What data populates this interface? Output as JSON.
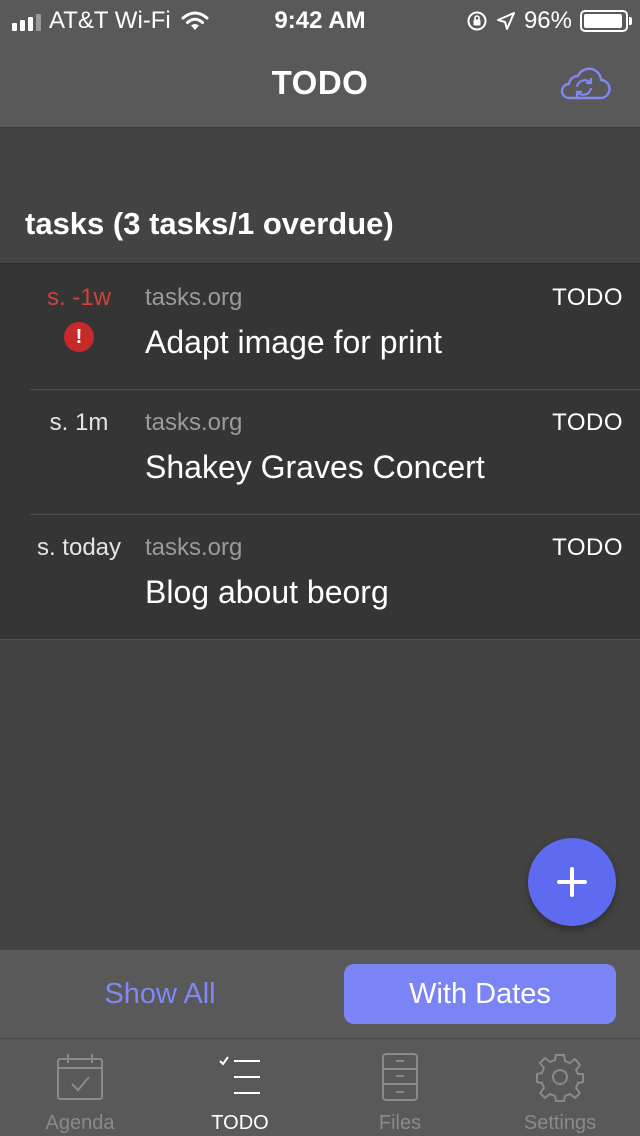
{
  "status_bar": {
    "carrier": "AT&T Wi-Fi",
    "time": "9:42 AM",
    "battery": "96%",
    "battery_level": 0.96
  },
  "nav": {
    "title": "TODO",
    "sync_icon": "cloud-sync-icon"
  },
  "section": {
    "header": "tasks (3 tasks/1 overdue)"
  },
  "tasks": [
    {
      "schedule": "s. -1w",
      "overdue": true,
      "file": "tasks.org",
      "keyword": "TODO",
      "title": "Adapt image for print"
    },
    {
      "schedule": "s. 1m",
      "overdue": false,
      "file": "tasks.org",
      "keyword": "TODO",
      "title": "Shakey Graves Concert"
    },
    {
      "schedule": "s. today",
      "overdue": false,
      "file": "tasks.org",
      "keyword": "TODO",
      "title": "Blog about beorg"
    }
  ],
  "overdue_icon": "!",
  "filter": {
    "show_all": "Show All",
    "with_dates": "With Dates"
  },
  "tabs": [
    {
      "label": "Agenda",
      "icon": "calendar-icon"
    },
    {
      "label": "TODO",
      "icon": "checklist-icon",
      "active": true
    },
    {
      "label": "Files",
      "icon": "cabinet-icon"
    },
    {
      "label": "Settings",
      "icon": "gear-icon"
    }
  ],
  "colors": {
    "accent": "#7b84f5",
    "overdue": "#d2413b",
    "background": "#434343",
    "list_background": "#353535"
  }
}
